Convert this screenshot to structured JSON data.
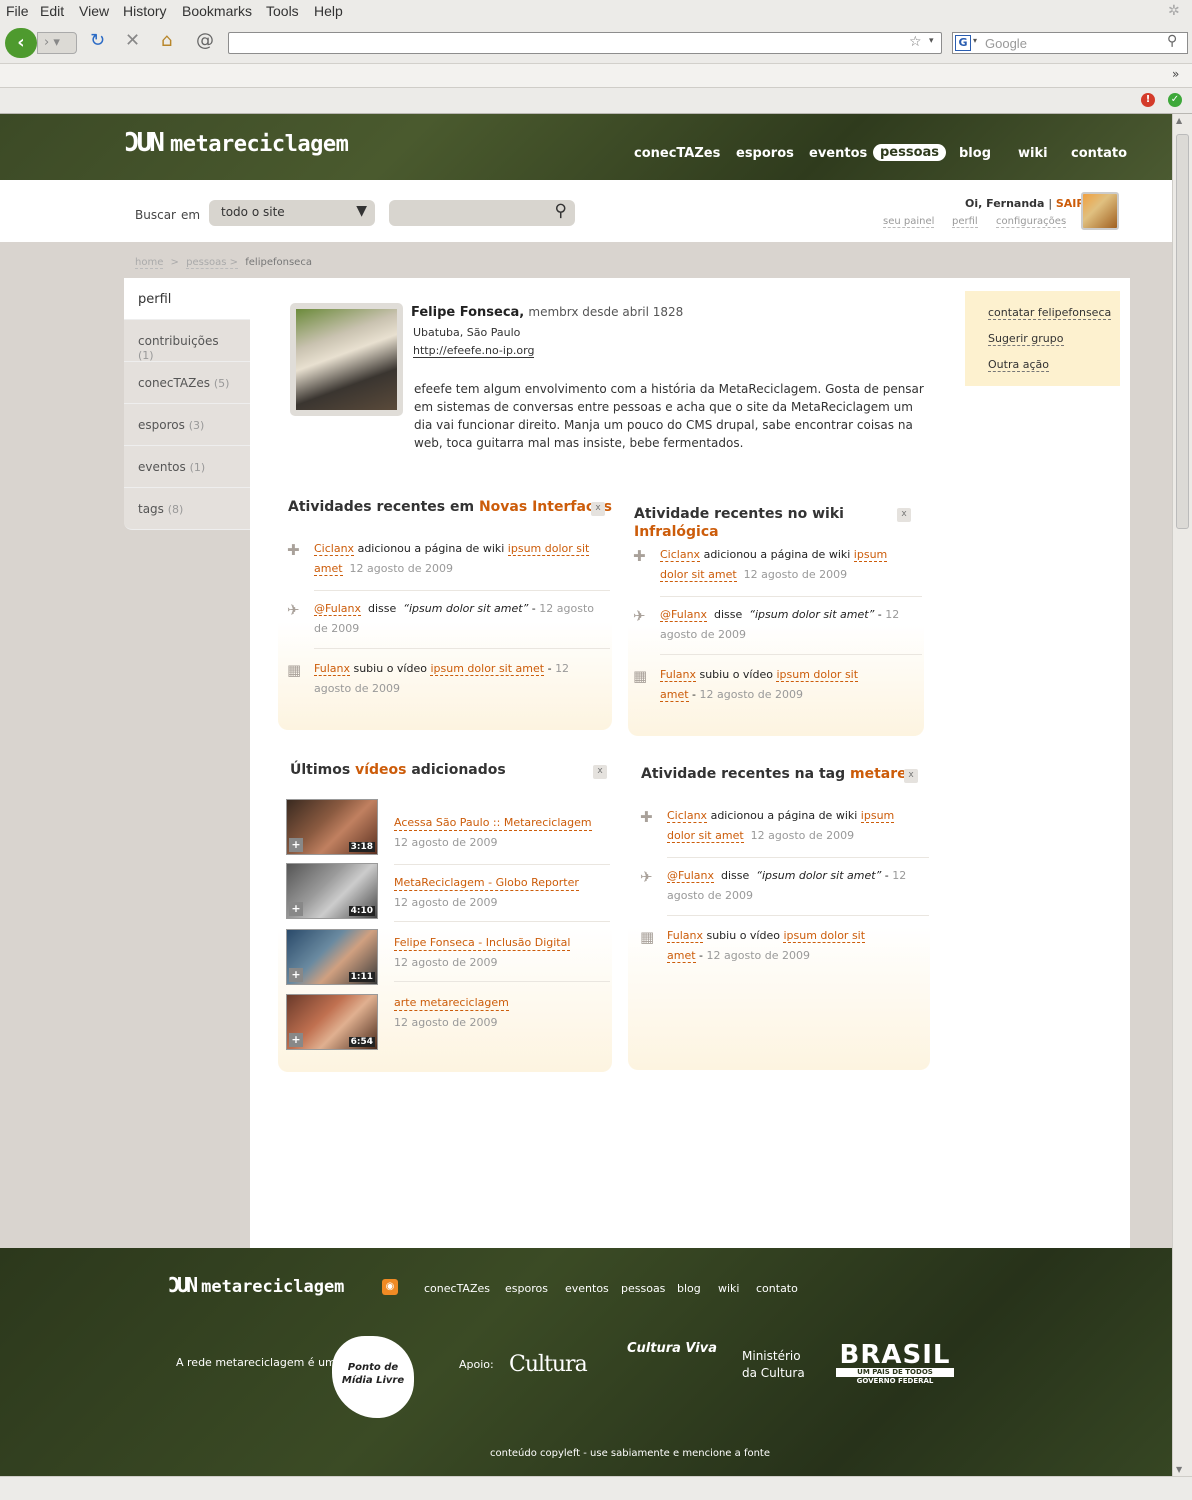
{
  "browser": {
    "menu": [
      "File",
      "Edit",
      "View",
      "History",
      "Bookmarks",
      "Tools",
      "Help"
    ],
    "search_placeholder": "Google"
  },
  "header": {
    "logo_mark": "ƆUN",
    "logo_text": "metareciclagem",
    "nav": [
      "conecTAZes",
      "esporos",
      "eventos",
      "pessoas",
      "blog",
      "wiki",
      "contato"
    ],
    "active_nav": "pessoas"
  },
  "search": {
    "label_buscar": "Buscar",
    "label_em": "em",
    "scope": "todo o site"
  },
  "user": {
    "greeting": "Oi, Fernanda",
    "sep": "|",
    "logout": "SAIR",
    "links": [
      "seu painel",
      "perfil",
      "configurações"
    ]
  },
  "breadcrumb": {
    "items": [
      "home",
      ">",
      "pessoas >",
      "felipefonseca"
    ]
  },
  "tabs": [
    {
      "label": "perfil",
      "count": ""
    },
    {
      "label": "contribuições",
      "count": "(1)"
    },
    {
      "label": "conecTAZes",
      "count": "(5)"
    },
    {
      "label": "esporos",
      "count": "(3)"
    },
    {
      "label": "eventos",
      "count": "(1)"
    },
    {
      "label": "tags",
      "count": "(8)"
    }
  ],
  "profile": {
    "name": "Felipe Fonseca,",
    "since": "membrx desde abril 1828",
    "location": "Ubatuba, São Paulo",
    "url": "http://efeefe.no-ip.org",
    "bio": "efeefe tem algum envolvimento com a história da MetaReciclagem. Gosta de pensar em sistemas  de conversas entre pessoas e acha que o site da MetaReciclagem um dia vai funcionar direito. Manja um pouco do CMS drupal, sabe encontrar coisas na web, toca guitarra mal mas insiste, bebe fermentados."
  },
  "actions": [
    "contatar felipefonseca",
    "Sugerir grupo",
    "Outra ação"
  ],
  "box1": {
    "title_pre": "Atividades recentes em",
    "title_hl": "Novas Interfaces",
    "close": "x",
    "items": [
      {
        "user": "Ciclanx",
        "verb": "adicionou a página de wiki",
        "obj": "ipsum dolor sit amet",
        "date": "12 agosto de 2009"
      },
      {
        "user": "@Fulanx",
        "verb": "disse",
        "quote": "“ipsum dolor sit amet”",
        "sep": "-",
        "date": "12 agosto de 2009"
      },
      {
        "user": "Fulanx",
        "verb": "subiu o vídeo",
        "obj": "ipsum dolor sit amet",
        "sep": "-",
        "date": "12 agosto de 2009"
      }
    ]
  },
  "box2": {
    "title_pre": "Atividade  recentes no wiki",
    "title_hl": "Infralógica",
    "close": "x",
    "items": [
      {
        "user": "Ciclanx",
        "verb": "adicionou a página de wiki",
        "obj": "ipsum dolor sit amet",
        "date": "12 agosto de 2009"
      },
      {
        "user": "@Fulanx",
        "verb": "disse",
        "quote": "“ipsum dolor sit amet”",
        "sep": "-",
        "date": "12 agosto de 2009"
      },
      {
        "user": "Fulanx",
        "verb": "subiu o vídeo",
        "obj": "ipsum dolor sit amet",
        "sep": "-",
        "date": "12 agosto de 2009"
      }
    ]
  },
  "box3": {
    "title_pre": "Últimos",
    "title_hl": "vídeos",
    "title_post": "adicionados",
    "close": "x",
    "videos": [
      {
        "title": "Acessa São Paulo :: Metareciclagem",
        "date": "12 agosto de 2009",
        "duration": "3:18",
        "color": "#7a3a2a"
      },
      {
        "title": "MetaReciclagem - Globo Reporter",
        "date": "12 agosto de 2009",
        "duration": "4:10",
        "color": "#777777"
      },
      {
        "title": "Felipe Fonseca - Inclusão Digital",
        "date": "12 agosto de 2009",
        "duration": "1:11",
        "color": "#5a6a7a"
      },
      {
        "title": "arte metareciclagem",
        "date": "12 agosto de 2009",
        "duration": "6:54",
        "color": "#8a4a3a"
      }
    ]
  },
  "box4": {
    "title_pre": "Atividade  recentes na tag",
    "title_hl": "metarec",
    "close": "x",
    "items": [
      {
        "user": "Ciclanx",
        "verb": "adicionou a página de wiki",
        "obj": "ipsum dolor sit amet",
        "date": "12 agosto de 2009"
      },
      {
        "user": "@Fulanx",
        "verb": "disse",
        "quote": "“ipsum dolor sit amet”",
        "sep": "-",
        "date": "12 agosto de 2009"
      },
      {
        "user": "Fulanx",
        "verb": "subiu o vídeo",
        "obj": "ipsum dolor sit amet",
        "sep": "-",
        "date": "12 agosto de 2009"
      }
    ]
  },
  "footer": {
    "logo_mark": "ƆUN",
    "logo_text": "metareciclagem",
    "nav": [
      "conecTAZes",
      "esporos",
      "eventos",
      "pessoas",
      "blog",
      "wiki",
      "contato"
    ],
    "rede": "A rede metareciclagem é um",
    "ponto_logo": "Ponto de Mídia Livre",
    "apoio": "Apoio:",
    "sponsors": [
      "Cultura",
      "Cultura Viva",
      "Ministério",
      "da Cultura",
      "BRASIL",
      "UM PAÍS DE TODOS",
      "GOVERNO FEDERAL"
    ],
    "copyleft": "conteúdo copyleft - use sabiamente e mencione a fonte"
  },
  "colors": {
    "accent": "#cc5c0a",
    "header_green": "#3c4a26"
  }
}
